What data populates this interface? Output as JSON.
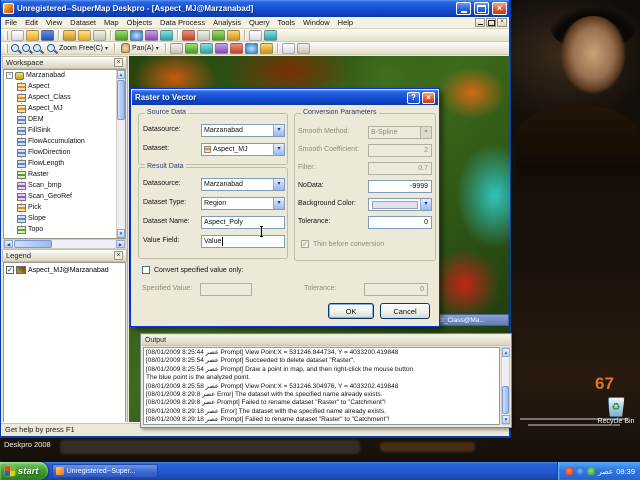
{
  "window": {
    "title": "Unregistered--SuperMap Deskpro - [Aspect_MJ@Marzanabad]"
  },
  "menu": [
    "File",
    "Edit",
    "View",
    "Dataset",
    "Map",
    "Objects",
    "Data Process",
    "Analysis",
    "Query",
    "Tools",
    "Window",
    "Help"
  ],
  "toolbar": {
    "zoom_free": "Zoom Free(C)",
    "pan": "Pan(A)"
  },
  "workspace": {
    "title": "Workspace",
    "root": "Marzanabad",
    "items": [
      "Aspect",
      "Aspect_Class",
      "Aspect_MJ",
      "DEM",
      "FillSink",
      "FlowAccumulation",
      "FlowDirection",
      "FlowLength",
      "Raster",
      "Scan_bmp",
      "Scan_GeoRef",
      "Pick",
      "Slope",
      "Topo"
    ]
  },
  "legend": {
    "title": "Legend",
    "item": "Aspect_MJ@Marzanabad"
  },
  "map": {
    "child_caption": "Aspect_Class@Ma..."
  },
  "dialog": {
    "title": "Raster to Vector",
    "groups": {
      "source": "Source Data",
      "conversion": "Conversion Parameters",
      "result": "Result Data"
    },
    "labels": {
      "datasource": "Datasource:",
      "dataset": "Dataset:",
      "smooth_method": "Smooth Method:",
      "smooth_coefficient": "Smooth Coefficient:",
      "filter": "Filter:",
      "nodata": "NoData:",
      "background_color": "Background Color:",
      "tolerance": "Tolerance:",
      "thin": "Thin before conversion",
      "dataset_type": "Dataset Type:",
      "dataset_name": "Dataset Name:",
      "value_field": "Value Field:",
      "convert_specified": "Convert specified value only:",
      "specified_value": "Specified Value:"
    },
    "values": {
      "source_datasource": "Marzanabad",
      "source_dataset": "Aspect_MJ",
      "smooth_method": "B-Spline",
      "smooth_coefficient": "2",
      "filter": "0.7",
      "nodata": "-9999",
      "conv_tolerance": "0",
      "result_datasource": "Marzanabad",
      "dataset_type": "Region",
      "dataset_name": "Aspect_Poly",
      "value_field": "Value",
      "specified_value": "",
      "spec_tolerance": "0"
    },
    "buttons": {
      "ok": "OK",
      "cancel": "Cancel"
    }
  },
  "output": {
    "title": "Output",
    "lines": [
      "[08/01/2009 8:25:44 عصر  Prompt]  View Point:X = 531246.844734, Y = 4033200.419848",
      "[08/01/2009 8:25:54 عصر  Prompt]  Succeeded to delete dataset \"Raster\".",
      "[08/01/2009 8:25:54 عصر  Prompt]  Draw a point in map, and then right-click the mouse button",
      "The blue point is the analyzed point.",
      "[08/01/2009 8:25:58 عصر  Prompt]  View Point:X = 531246.304976, Y = 4033202.419848",
      "[08/01/2009 8:29:8 عصر  Error]  The dataset with the specified name already exists.",
      "[08/01/2009 8:29:8 عصر  Prompt]  Failed to rename dataset \"Raster\" to \"Catchment\"!",
      "[08/01/2009 8:29:18 عصر  Error]  The dataset with the specified name already exists.",
      "[08/01/2009 8:29:18 عصر  Prompt]  Failed to rename dataset \"Raster\" to \"Catchment\"!"
    ]
  },
  "status": {
    "help": "Get help by press F1"
  },
  "desktop": {
    "brand": "Deskpro 2008",
    "recycle_bin": "Recycle Bin",
    "poster_number": "67"
  },
  "taskbar": {
    "start": "start",
    "task": "Unregistered--Super...",
    "time": "08:39",
    "period": "عصر"
  },
  "icons": {
    "close": "×",
    "help": "?",
    "dropdown": "▾",
    "check": "✓",
    "collapse": "−",
    "arrow_up": "▲",
    "arrow_down": "▼",
    "arrow_left": "◀",
    "arrow_right": "▶",
    "recycle": "♻"
  }
}
